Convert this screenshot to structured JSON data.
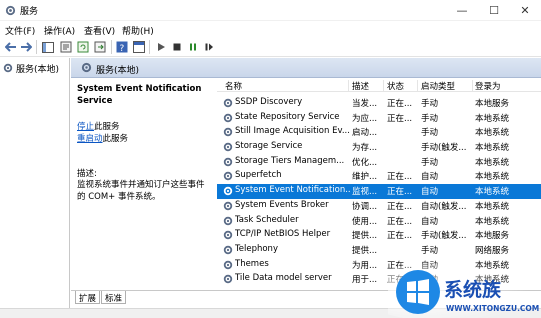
{
  "window": {
    "title": "服务"
  },
  "menu": [
    "文件(F)",
    "操作(A)",
    "查看(V)",
    "帮助(H)"
  ],
  "tree": {
    "root": "服务(本地)"
  },
  "header": {
    "title": "服务(本地)"
  },
  "description": {
    "service_name": "System Event Notification Service",
    "stop_link": "停止",
    "stop_rest": "此服务",
    "restart_link": "重启动",
    "restart_rest": "此服务",
    "desc_label": "描述:",
    "desc_text": "监视系统事件并通知订户这些事件的 COM+ 事件系统。"
  },
  "columns": {
    "name": "名称",
    "description": "描述",
    "status": "状态",
    "startup": "启动类型",
    "logon": "登录为"
  },
  "services": [
    {
      "name": "SSDP Discovery",
      "desc": "当发...",
      "status": "正在...",
      "startup": "手动",
      "logon": "本地服务",
      "selected": false
    },
    {
      "name": "State Repository Service",
      "desc": "为应...",
      "status": "正在...",
      "startup": "手动",
      "logon": "本地系统",
      "selected": false
    },
    {
      "name": "Still Image Acquisition Ev...",
      "desc": "启动...",
      "status": "",
      "startup": "手动",
      "logon": "本地系统",
      "selected": false
    },
    {
      "name": "Storage Service",
      "desc": "为存...",
      "status": "",
      "startup": "手动(触发...",
      "logon": "本地系统",
      "selected": false
    },
    {
      "name": "Storage Tiers Managem...",
      "desc": "优化...",
      "status": "",
      "startup": "手动",
      "logon": "本地系统",
      "selected": false
    },
    {
      "name": "Superfetch",
      "desc": "维护...",
      "status": "正在...",
      "startup": "自动",
      "logon": "本地系统",
      "selected": false
    },
    {
      "name": "System Event Notification...",
      "desc": "监视...",
      "status": "正在...",
      "startup": "自动",
      "logon": "本地系统",
      "selected": true
    },
    {
      "name": "System Events Broker",
      "desc": "协调...",
      "status": "正在...",
      "startup": "自动(触发...",
      "logon": "本地系统",
      "selected": false
    },
    {
      "name": "Task Scheduler",
      "desc": "使用...",
      "status": "正在...",
      "startup": "自动",
      "logon": "本地系统",
      "selected": false
    },
    {
      "name": "TCP/IP NetBIOS Helper",
      "desc": "提供...",
      "status": "正在...",
      "startup": "手动(触发...",
      "logon": "本地服务",
      "selected": false
    },
    {
      "name": "Telephony",
      "desc": "提供...",
      "status": "",
      "startup": "手动",
      "logon": "网络服务",
      "selected": false
    },
    {
      "name": "Themes",
      "desc": "为用...",
      "status": "正在...",
      "startup": "自动",
      "logon": "本地系统",
      "selected": false
    },
    {
      "name": "Tile Data model server",
      "desc": "用于...",
      "status": "正在...",
      "startup": "自动",
      "logon": "本地系统",
      "selected": false
    }
  ],
  "tabs": [
    "扩展",
    "标准"
  ],
  "watermark": {
    "brand": "系统族",
    "url": "WWW.XITONGZU.COM"
  },
  "colors": {
    "selection": "#0a78d7",
    "link": "#0b56c3",
    "header_gradient_top": "#dde6f3"
  }
}
